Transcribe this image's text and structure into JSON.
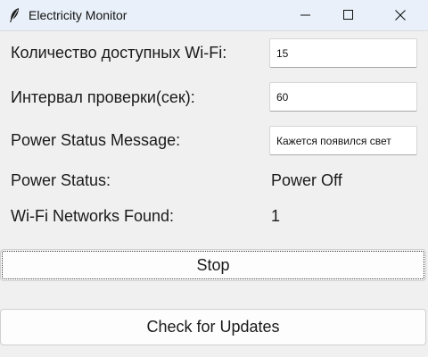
{
  "window": {
    "title": "Electricity Monitor",
    "icon": "feather-icon"
  },
  "fields": {
    "wifi_count_label": "Количество доступных Wi-Fi:",
    "wifi_count_value": "15",
    "interval_label": "Интервал проверки(сек):",
    "interval_value": "60",
    "message_label": "Power Status Message:",
    "message_value": "Кажется появился свет"
  },
  "status": {
    "power_label": "Power Status:",
    "power_value": "Power Off",
    "networks_label": "Wi-Fi Networks Found:",
    "networks_value": "1"
  },
  "buttons": {
    "stop": "Stop",
    "check_updates": "Check for Updates"
  }
}
